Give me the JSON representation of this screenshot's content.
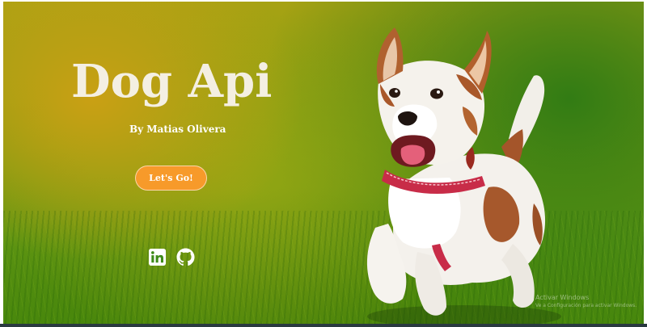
{
  "hero": {
    "title": "Dog Api",
    "byline": "By Matias Olivera",
    "cta_label": "Let's Go!"
  },
  "social": {
    "links": [
      {
        "icon": "linkedin-icon"
      },
      {
        "icon": "github-icon"
      }
    ]
  },
  "watermark": {
    "line1": "Activar Windows",
    "line2": "Ve a Configuración para activar Windows."
  },
  "colors": {
    "accent": "#f79a2a",
    "title": "#f4efe2",
    "text": "#ffffff"
  }
}
